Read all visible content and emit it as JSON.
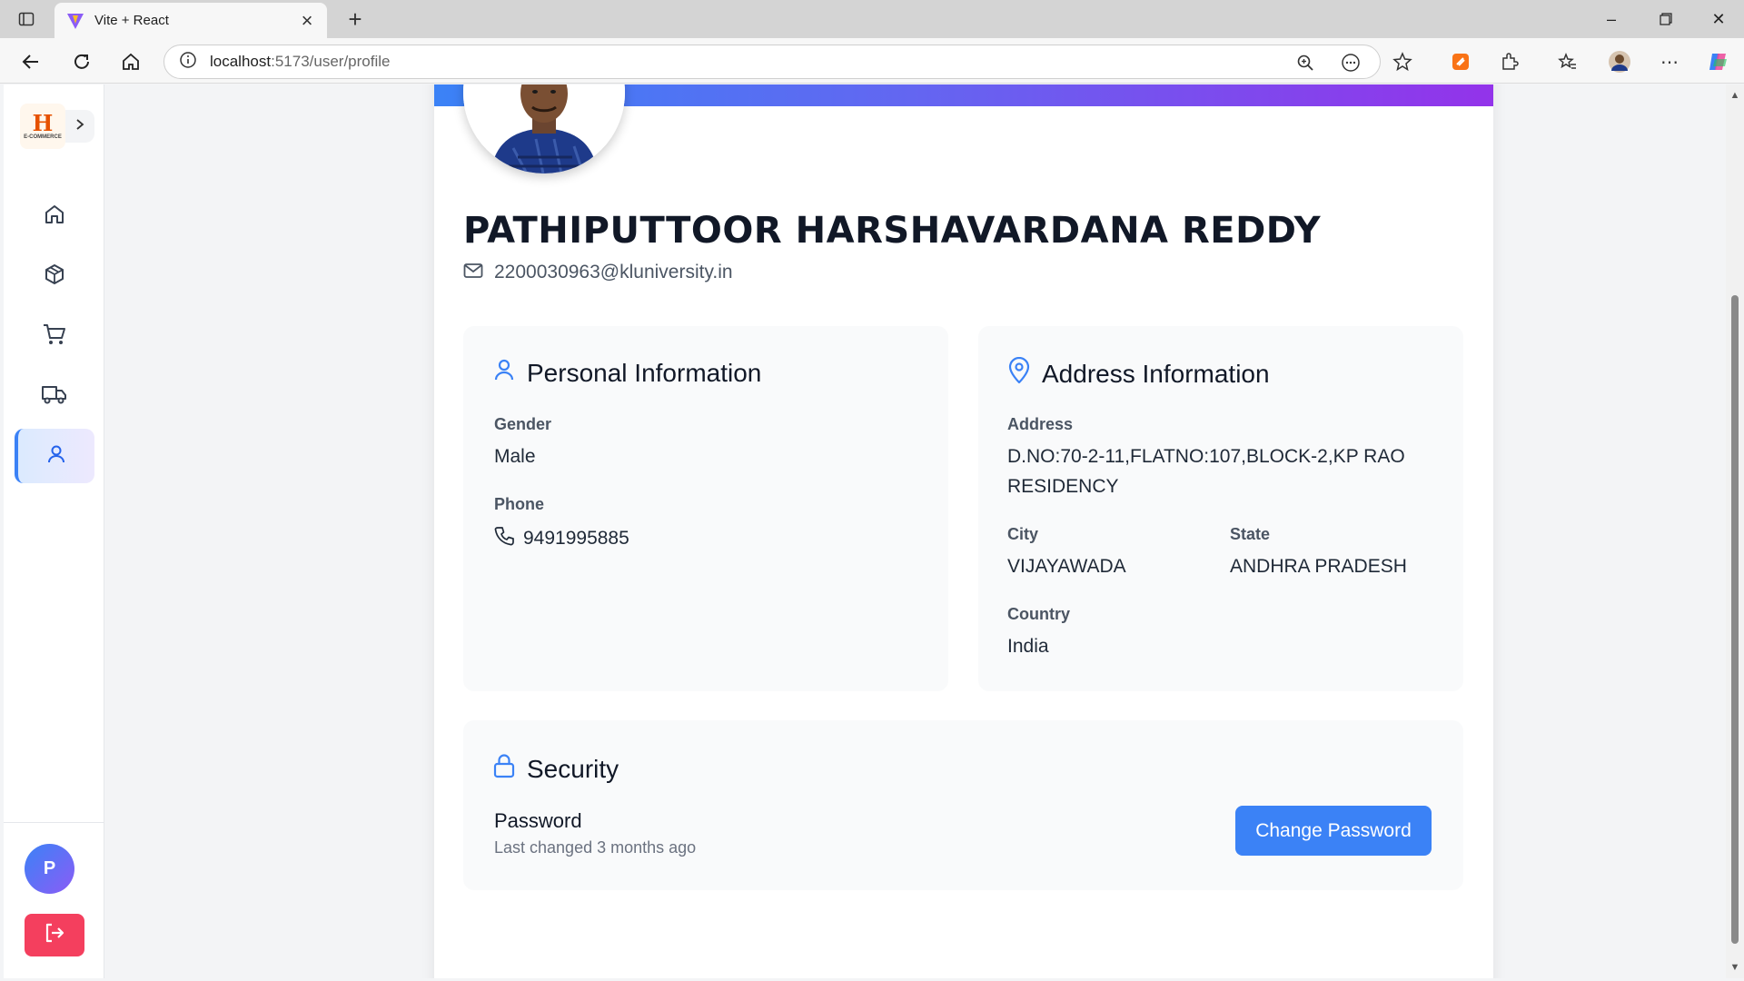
{
  "browser": {
    "tab_title": "Vite + React",
    "url_host": "localhost",
    "url_rest": ":5173/user/profile"
  },
  "sidebar": {
    "logo_text": "H",
    "logo_sub": "E-COMMERCE",
    "items": [
      {
        "name": "home",
        "icon": "home-icon"
      },
      {
        "name": "products",
        "icon": "box-icon"
      },
      {
        "name": "cart",
        "icon": "cart-icon"
      },
      {
        "name": "orders",
        "icon": "truck-icon"
      },
      {
        "name": "profile",
        "icon": "user-icon",
        "active": true
      }
    ],
    "avatar_initial": "P"
  },
  "profile": {
    "name": "PATHIPUTTOOR HARSHAVARDANA REDDY",
    "email": "2200030963@kluniversity.in"
  },
  "personal": {
    "heading": "Personal Information",
    "gender_label": "Gender",
    "gender": "Male",
    "phone_label": "Phone",
    "phone": "9491995885"
  },
  "address": {
    "heading": "Address Information",
    "address_label": "Address",
    "address": "D.NO:70-2-11,FLATNO:107,BLOCK-2,KP RAO RESIDENCY",
    "city_label": "City",
    "city": "VIJAYAWADA",
    "state_label": "State",
    "state": "ANDHRA PRADESH",
    "country_label": "Country",
    "country": "India"
  },
  "security": {
    "heading": "Security",
    "password_label": "Password",
    "password_changed": "Last changed 3 months ago",
    "change_button": "Change Password"
  },
  "colors": {
    "accent": "#3b82f6",
    "banner_end": "#9333ea",
    "logout": "#f43f5e"
  }
}
